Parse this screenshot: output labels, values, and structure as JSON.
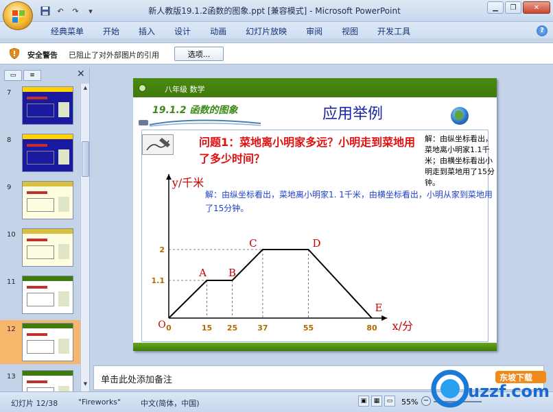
{
  "window": {
    "title": "新人教版19.1.2函数的图象.ppt [兼容模式] - Microsoft PowerPoint",
    "qat": [
      "save-icon",
      "undo-icon",
      "redo-icon",
      "customize-icon"
    ]
  },
  "menu": {
    "tabs": [
      "经典菜单",
      "开始",
      "插入",
      "设计",
      "动画",
      "幻灯片放映",
      "审阅",
      "视图",
      "开发工具"
    ]
  },
  "security": {
    "label": "安全警告",
    "message": "已阻止了对外部图片的引用",
    "button": "选项..."
  },
  "thumbnails": [
    {
      "num": "7",
      "style": "blue"
    },
    {
      "num": "8",
      "style": "blue"
    },
    {
      "num": "9",
      "style": "yellow"
    },
    {
      "num": "10",
      "style": "yellow"
    },
    {
      "num": "11",
      "style": "white"
    },
    {
      "num": "12",
      "style": "white",
      "selected": true
    },
    {
      "num": "13",
      "style": "white"
    }
  ],
  "slide": {
    "header": "八年级  数学",
    "section": "19.1.2 函数的图象",
    "title": "应用举例",
    "question": "问题1：菜地离小明家多远？小明走到菜地用了多少时间？",
    "answer": "解：由纵坐标看出，菜地离小明家1. 1千米，由横坐标看出，小明从家到菜地用了15分钟。",
    "note": "解：由纵坐标看出，菜地离小明家1.1千米；由横坐标看出小明走到菜地用了15分钟。",
    "ylabel": "y/千米",
    "xlabel": "x/分",
    "origin": "O",
    "points": [
      {
        "label": "A",
        "x": 15,
        "y": 1.1
      },
      {
        "label": "B",
        "x": 25,
        "y": 1.1
      },
      {
        "label": "C",
        "x": 37,
        "y": 2
      },
      {
        "label": "D",
        "x": 55,
        "y": 2
      },
      {
        "label": "E",
        "x": 80,
        "y": 0
      }
    ],
    "xticks": [
      "0",
      "15",
      "25",
      "37",
      "55",
      "80"
    ],
    "yticks": [
      "1.1",
      "2"
    ]
  },
  "notes": {
    "placeholder": "单击此处添加备注"
  },
  "status": {
    "slide": "幻灯片 12/38",
    "theme": "\"Fireworks\"",
    "language": "中文(简体，中国)",
    "zoom": "55%"
  },
  "watermark": {
    "brand": "uzzf.com",
    "cn": "东坡下载"
  },
  "colors": {
    "accent_green": "#3f7a0c",
    "question_red": "#e01010",
    "answer_blue": "#1f40c8",
    "graph_red": "#c80000"
  }
}
